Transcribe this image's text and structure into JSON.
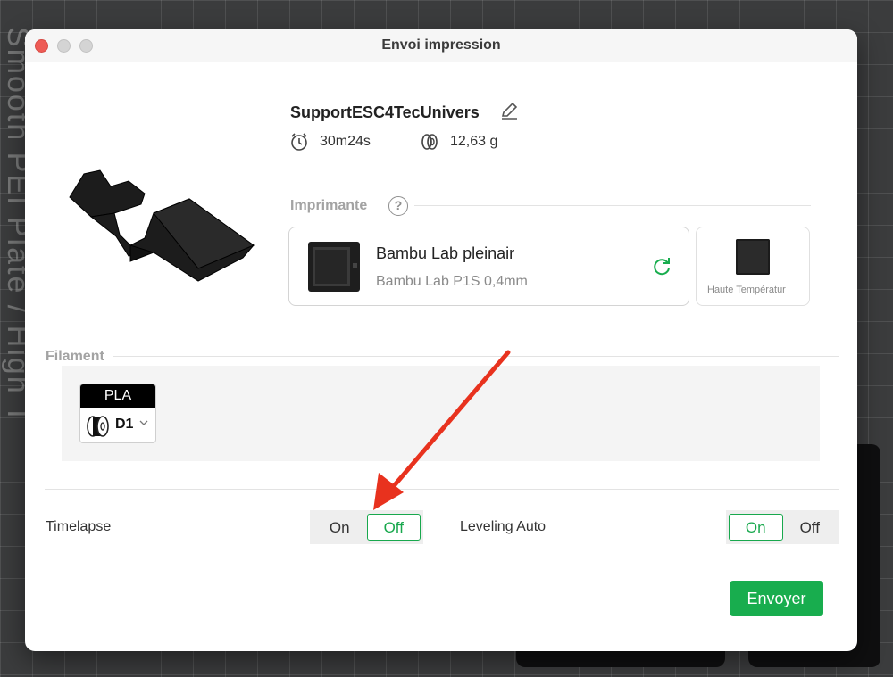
{
  "background": {
    "plate_text": "Smooth PEI Plate / High T"
  },
  "window": {
    "title": "Envoi impression",
    "traffic_lights": [
      "close",
      "minimize",
      "maximize"
    ]
  },
  "project": {
    "name": "SupportESC4TecUnivers",
    "time": "30m24s",
    "weight": "12,63 g"
  },
  "printer_section": {
    "label": "Imprimante",
    "help": "?",
    "printer_name": "Bambu Lab pleinair",
    "printer_model": "Bambu Lab P1S  0,4mm",
    "plate_label": "Haute Températur"
  },
  "filament_section": {
    "label": "Filament",
    "slots": [
      {
        "type": "PLA",
        "slot": "D1",
        "color": "#000000"
      }
    ]
  },
  "options": {
    "timelapse": {
      "label": "Timelapse",
      "on": "On",
      "off": "Off",
      "selected": "off"
    },
    "leveling": {
      "label": "Leveling Auto",
      "on": "On",
      "off": "Off",
      "selected": "on"
    }
  },
  "actions": {
    "send_label": "Envoyer"
  },
  "colors": {
    "accent": "#18ad4e",
    "annotation": "#e8321e"
  }
}
